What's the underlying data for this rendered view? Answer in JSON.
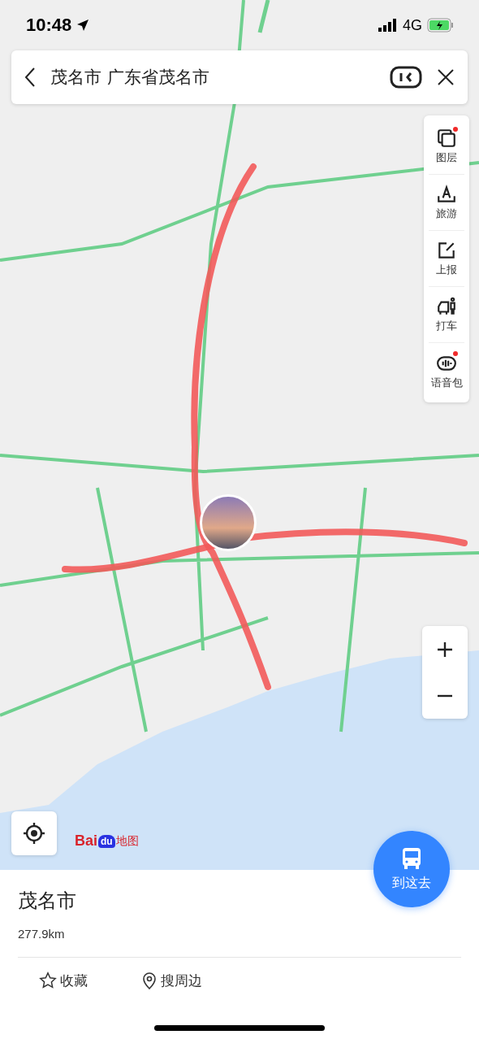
{
  "status_bar": {
    "time": "10:48",
    "network": "4G"
  },
  "search": {
    "value": "茂名市 广东省茂名市"
  },
  "tools": [
    {
      "label": "图层",
      "kind": "layers",
      "badge": true
    },
    {
      "label": "旅游",
      "kind": "travel",
      "badge": false
    },
    {
      "label": "上报",
      "kind": "report",
      "badge": false
    },
    {
      "label": "打车",
      "kind": "taxi",
      "badge": false
    },
    {
      "label": "语音包",
      "kind": "voice",
      "badge": true
    }
  ],
  "logo": {
    "part_1": "Bai",
    "part_2": "du",
    "part_3": "地图"
  },
  "go_button": {
    "label": "到这去"
  },
  "place": {
    "title": "茂名市",
    "distance": "277.9km"
  },
  "actions": [
    {
      "label": "收藏",
      "kind": "star"
    },
    {
      "label": "搜周边",
      "kind": "pin"
    }
  ]
}
